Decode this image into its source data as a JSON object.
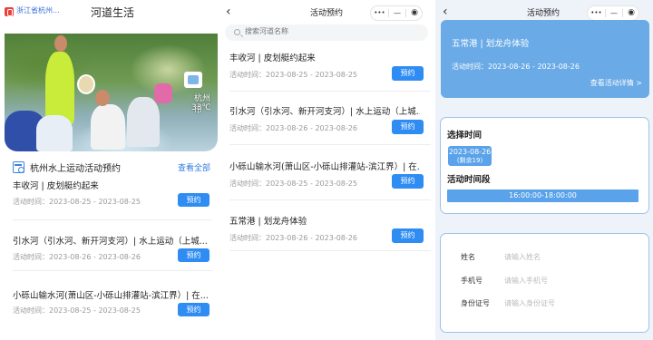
{
  "home": {
    "logo_text": "浙江省杭州...",
    "title": "河道生活",
    "weather": {
      "city": "杭州市",
      "temp": "33℃"
    },
    "section_title": "杭州水上运动活动预约",
    "see_all": "查看全部",
    "items": [
      {
        "name": "丰收河 | 皮划艇约起来",
        "time": "活动时间：2023-08-25 - 2023-08-25",
        "btn": "预约"
      },
      {
        "name": "引水河（引水河、新开河支河）| 水上运动（上城...",
        "time": "活动时间：2023-08-26 - 2023-08-26",
        "btn": "预约"
      },
      {
        "name": "小砾山输水河(萧山区-小砾山排灌站-滨江界）| 在...",
        "time": "活动时间：2023-08-25 - 2023-08-25",
        "btn": "预约"
      }
    ]
  },
  "list": {
    "nav_title": "活动预约",
    "search_placeholder": "搜索河道名称",
    "items": [
      {
        "name": "丰收河 | 皮划艇约起来",
        "time": "活动时间：2023-08-25 - 2023-08-25",
        "btn": "预约"
      },
      {
        "name": "引水河（引水河、新开河支河）| 水上运动（上城...",
        "time": "活动时间：2023-08-26 - 2023-08-26",
        "btn": "预约"
      },
      {
        "name": "小砾山输水河(萧山区-小砾山排灌站-滨江界）| 在...",
        "time": "活动时间：2023-08-25 - 2023-08-25",
        "btn": "预约"
      },
      {
        "name": "五常港 | 划龙舟体验",
        "time": "活动时间：2023-08-26 - 2023-08-26",
        "btn": "预约"
      }
    ]
  },
  "detail": {
    "nav_title": "活动预约",
    "title": "五常港 | 划龙舟体验",
    "time": "活动时间：2023-08-26 - 2023-08-26",
    "view_detail": "查看活动详情 >",
    "choose_time_label": "选择时间",
    "date_chip": {
      "date": "2023-08-26",
      "remain": "(剩余19)"
    },
    "slot_label": "活动时间段",
    "slot": "16:00:00-18:00:00",
    "form": {
      "name_label": "姓名",
      "name_placeholder": "请输入姓名",
      "phone_label": "手机号",
      "phone_placeholder": "请输入手机号",
      "id_label": "身份证号",
      "id_placeholder": "请输入身份证号"
    }
  },
  "capsule": {
    "more": "•••",
    "minus": "—",
    "close": "◉"
  },
  "colors": {
    "primary": "#2f8cf3",
    "hero": "#6aaae6",
    "chip": "#5aa2ea"
  }
}
